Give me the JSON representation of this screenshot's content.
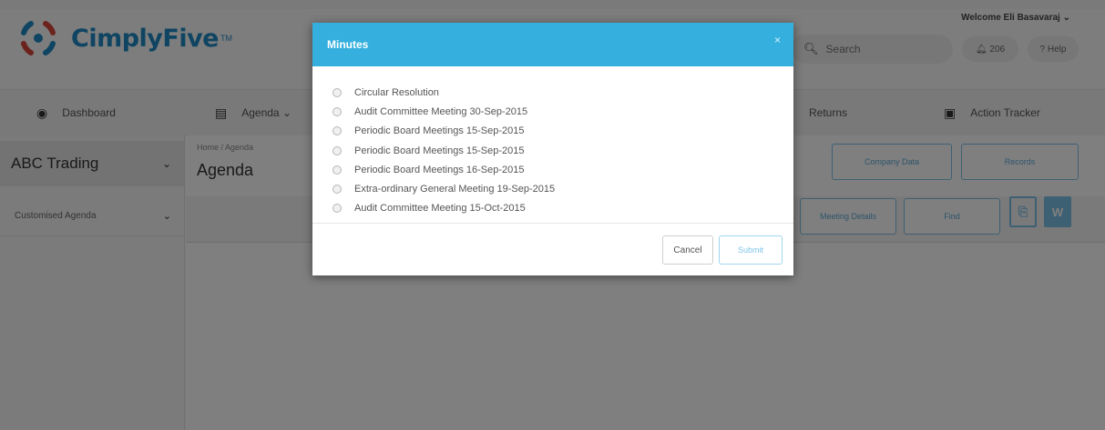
{
  "brand": {
    "name": "CimplyFive",
    "tm": "TM"
  },
  "header": {
    "welcome": "Welcome Eli Basavaraj",
    "search_placeholder": "Search",
    "notifications_label": "206",
    "help_label": "Help"
  },
  "nav": {
    "items": [
      {
        "label": "Dashboard",
        "icon": "dashboard-icon"
      },
      {
        "label": "Agenda",
        "icon": "agenda-icon"
      },
      {
        "label": "Returns",
        "icon": ""
      },
      {
        "label": "Action Tracker",
        "icon": "action-tracker-icon"
      }
    ]
  },
  "sidebar": {
    "company": "ABC Trading",
    "agenda_type": "Customised Agenda"
  },
  "main": {
    "breadcrumb": "Home / Agenda",
    "title": "Agenda",
    "buttons": {
      "company_data": "Company Data",
      "records": "Records",
      "meeting_details": "Meeting Details",
      "find": "Find"
    },
    "doc_icons": [
      "pdf-icon",
      "word-icon"
    ]
  },
  "modal": {
    "title": "Minutes",
    "close": "×",
    "options": [
      "Circular Resolution",
      "Audit Committee Meeting 30-Sep-2015",
      "Periodic Board Meetings 15-Sep-2015",
      "Periodic Board Meetings 15-Sep-2015",
      "Periodic Board Meetings 16-Sep-2015",
      "Extra-ordinary General Meeting 19-Sep-2015",
      "Audit Committee Meeting 15-Oct-2015"
    ],
    "cancel_label": "Cancel",
    "submit_label": "Submit"
  },
  "colors": {
    "brand_blue": "#1f8bc4",
    "modal_header": "#35b0de",
    "button_outline": "#7cc0e6"
  }
}
